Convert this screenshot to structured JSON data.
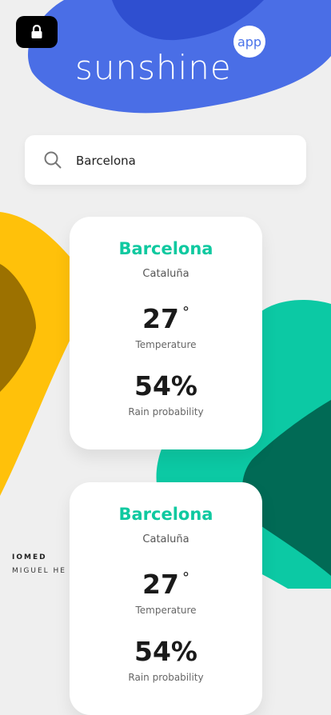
{
  "header": {
    "title": "sunshine",
    "badge": "app"
  },
  "search": {
    "value": "Barcelona",
    "placeholder": "Barcelona"
  },
  "cards": [
    {
      "city": "Barcelona",
      "region": "Cataluña",
      "temperature": "27",
      "degree": "°",
      "temperature_label": "Temperature",
      "rain": "54%",
      "rain_label": "Rain probability"
    },
    {
      "city": "Barcelona",
      "region": "Cataluña",
      "temperature": "27",
      "degree": "°",
      "temperature_label": "Temperature",
      "rain": "54%",
      "rain_label": "Rain probability"
    }
  ],
  "credits": {
    "line1": "IOMED",
    "line2": "MIGUEL HE"
  },
  "icons": {
    "lock": "lock-icon",
    "search": "search-icon"
  },
  "colors": {
    "blue": "#4a73ea",
    "teal": "#0fc9a0",
    "yellow": "#ffc20a",
    "dark_green": "#006b56"
  }
}
